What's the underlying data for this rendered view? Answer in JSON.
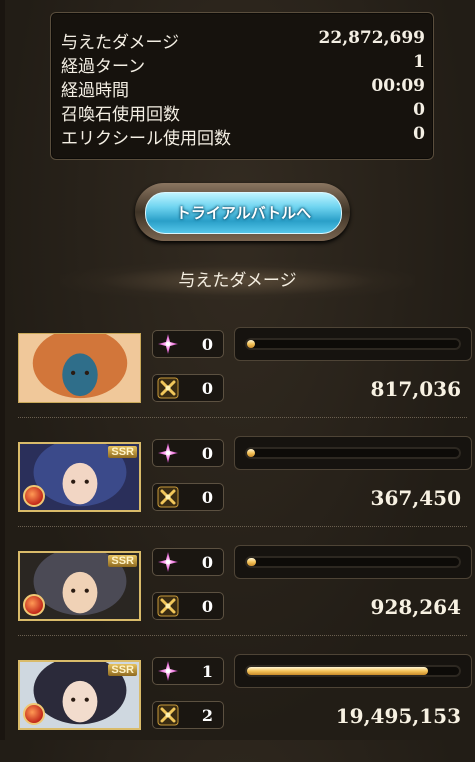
{
  "summary": {
    "rows": [
      {
        "label": "与えたダメージ",
        "value": "22,872,699"
      },
      {
        "label": "経過ターン",
        "value": "1"
      },
      {
        "label": "経過時間",
        "value": "00:09"
      },
      {
        "label": "召喚石使用回数",
        "value": "0"
      },
      {
        "label": "エリクシール使用回数",
        "value": "0"
      }
    ]
  },
  "trial_button": {
    "label": "トライアルバトルへ"
  },
  "section_title": "与えたダメージ",
  "members": [
    {
      "portrait": "gran-and-djeeta",
      "ssr": false,
      "ability_count": "0",
      "ougi_count": "0",
      "damage": "817,036",
      "damage_share": 0.036
    },
    {
      "portrait": "character-2-fire",
      "ssr": true,
      "ssr_label": "SSR",
      "ability_count": "0",
      "ougi_count": "0",
      "damage": "367,450",
      "damage_share": 0.016
    },
    {
      "portrait": "character-3-fire",
      "ssr": true,
      "ssr_label": "SSR",
      "ability_count": "0",
      "ougi_count": "0",
      "damage": "928,264",
      "damage_share": 0.041
    },
    {
      "portrait": "character-4-fire",
      "ssr": true,
      "ssr_label": "SSR",
      "ability_count": "1",
      "ougi_count": "2",
      "damage": "19,495,153",
      "damage_share": 0.852
    }
  ],
  "icons": {
    "ability": "pink-sparkle-icon",
    "ougi": "gold-cross-swords-icon",
    "element": "fire-element-icon"
  },
  "colors": {
    "gauge_fill": "#f4c45a",
    "button": "#55c7ea"
  }
}
